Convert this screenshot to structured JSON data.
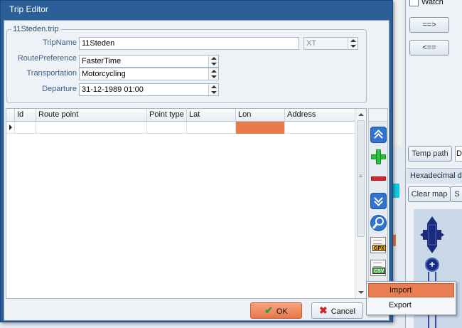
{
  "background_app": {
    "watch_label": "Watch",
    "move_right_label": "==>",
    "move_left_label": "<==",
    "temp_path_label": "Temp path",
    "field_fragment": "D",
    "tab_label": "Hexadecimal dis",
    "clear_map_label": "Clear map",
    "small_button_label": "S",
    "zoom_in_label": "+"
  },
  "dialog": {
    "title": "Trip Editor",
    "group_title": "11Steden.trip",
    "trip_name_label": "TripName",
    "trip_name_value": "11Steden",
    "trip_name_extra": "XT",
    "route_pref_label": "RoutePreference",
    "route_pref_value": "FasterTime",
    "transport_label": "Transportation",
    "transport_value": "Motorcycling",
    "departure_label": "Departure",
    "departure_value": "31-12-1989 01:00"
  },
  "grid": {
    "columns": [
      "Id",
      "Route point",
      "Point type",
      "Lat",
      "Lon",
      "Address"
    ],
    "rows": [
      {
        "id": "",
        "route_point": "",
        "point_type": "",
        "lat": "",
        "lon": "",
        "address": ""
      }
    ],
    "selected_column": "Lon"
  },
  "toolbar": {
    "icons": [
      "move-top-icon",
      "add-icon",
      "remove-icon",
      "move-bottom-icon",
      "search-icon",
      "gpx-file-icon",
      "csv-file-icon"
    ],
    "gpx_tag": "GPX",
    "csv_tag": "CSV"
  },
  "buttons": {
    "ok_label": "OK",
    "cancel_label": "Cancel"
  },
  "context_menu": {
    "items": [
      "Import",
      "Export"
    ],
    "highlighted": "Import"
  },
  "colors": {
    "titlebar": "#2c5f97",
    "accent_orange": "#e97e52",
    "button_blue": "#2f74d0",
    "add_green": "#27c23a",
    "remove_red": "#d8262b"
  }
}
